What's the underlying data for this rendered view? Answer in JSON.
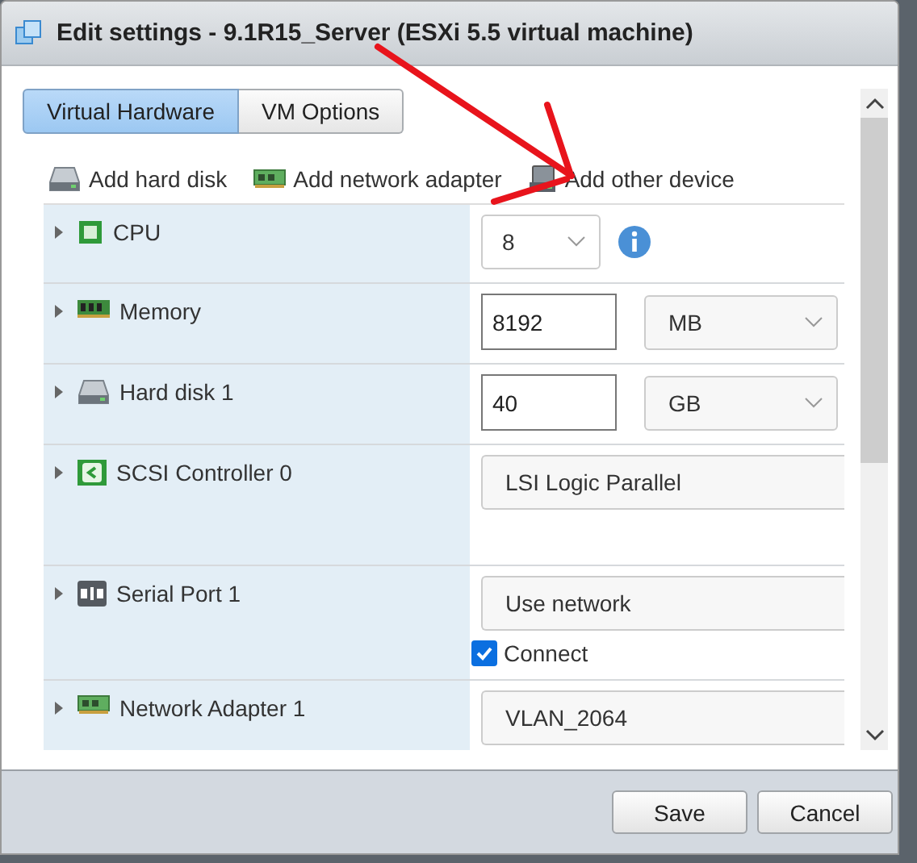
{
  "window": {
    "title": "Edit settings - 9.1R15_Server (ESXi 5.5 virtual machine)"
  },
  "tabs": [
    {
      "label": "Virtual Hardware",
      "selected": true
    },
    {
      "label": "VM Options",
      "selected": false
    }
  ],
  "toolbar": [
    {
      "label": "Add hard disk",
      "kind": "disk"
    },
    {
      "label": "Add network adapter",
      "kind": "network"
    },
    {
      "label": "Add other device",
      "kind": "device"
    }
  ],
  "devices": [
    {
      "label": "CPU",
      "kind": "cpu",
      "expanded": false,
      "fields": [
        {
          "kind": "small-select",
          "value": "8"
        },
        {
          "kind": "info"
        }
      ]
    },
    {
      "label": "Memory",
      "kind": "memory",
      "expanded": false,
      "fields": [
        {
          "kind": "input",
          "value": "8192"
        },
        {
          "kind": "unit-select",
          "value": "MB"
        }
      ]
    },
    {
      "label": "Hard disk 1",
      "kind": "disk",
      "expanded": false,
      "fields": [
        {
          "kind": "input",
          "value": "40"
        },
        {
          "kind": "unit-select",
          "value": "GB"
        }
      ]
    },
    {
      "label": "SCSI Controller 0",
      "kind": "scsi",
      "expanded": false,
      "fields": [
        {
          "kind": "wide-select",
          "value": "LSI Logic Parallel"
        }
      ]
    },
    {
      "label": "Serial Port 1",
      "kind": "serial",
      "expanded": false,
      "fields": [
        {
          "kind": "wide-select",
          "value": "Use network"
        },
        {
          "kind": "checkbox",
          "label": "Connect",
          "checked": true
        }
      ]
    },
    {
      "label": "Network Adapter 1",
      "kind": "network",
      "expanded": false,
      "fields": [
        {
          "kind": "wide-select",
          "value": "VLAN_2064"
        }
      ]
    }
  ],
  "buttons": [
    "Save",
    "Cancel"
  ]
}
